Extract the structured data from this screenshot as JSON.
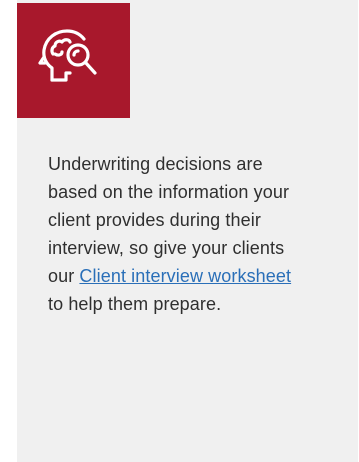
{
  "card": {
    "icon": "head-magnifier-icon",
    "text_before_link": "Underwriting decisions are based on the information your client provides during their interview, so give your clients our ",
    "link_text": "Client interview worksheet",
    "text_after_link": " to help them prepare."
  },
  "colors": {
    "tile": "#a8182c",
    "card_background": "#f0f0f0",
    "text": "#2f2f2f",
    "link": "#2a6fb8"
  }
}
